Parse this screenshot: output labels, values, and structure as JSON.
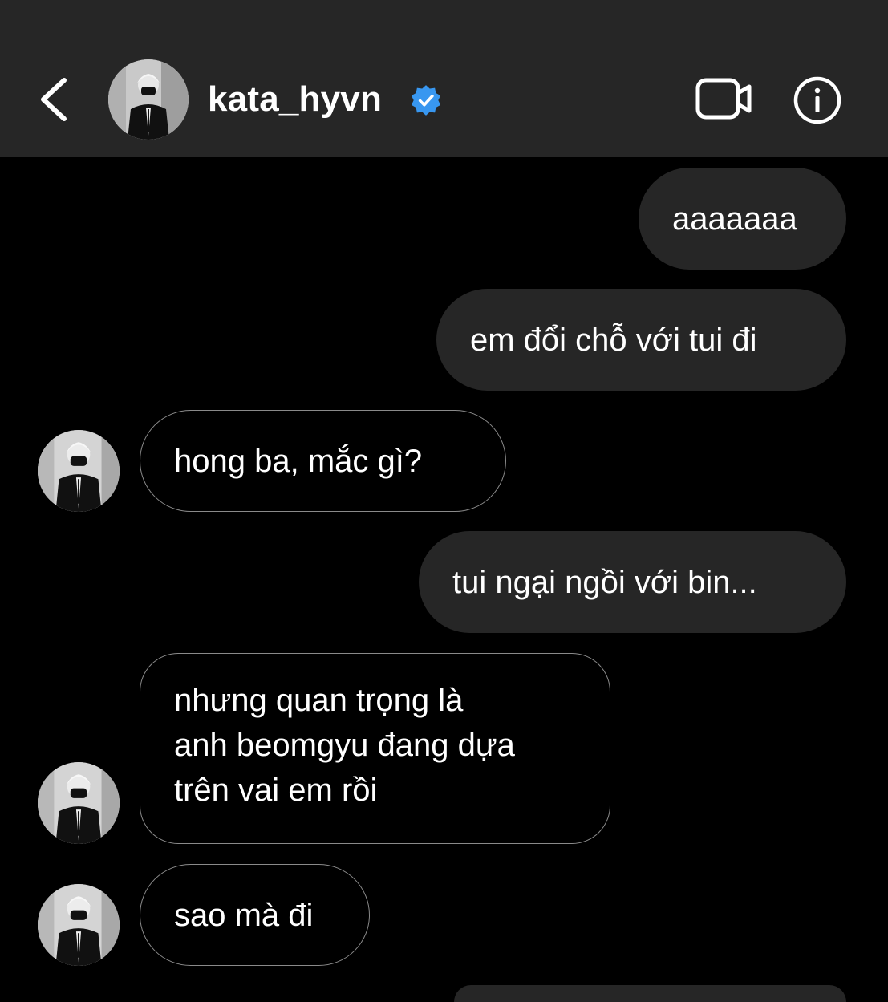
{
  "header": {
    "username": "kata_hyvn",
    "verified": true,
    "icons": [
      "back-chevron-icon",
      "avatar",
      "verified-badge-icon",
      "video-call-icon",
      "info-icon"
    ]
  },
  "messages": [
    {
      "side": "sent",
      "text": "aaaaaaa"
    },
    {
      "side": "sent",
      "text": "em đổi chỗ với tui đi"
    },
    {
      "side": "received",
      "text": "hong ba, mắc gì?"
    },
    {
      "side": "sent",
      "text": "tui ngại ngồi với bin..."
    },
    {
      "side": "received",
      "lines": [
        "nhưng quan trọng là",
        "anh beomgyu đang dựa",
        "trên vai em rồi"
      ]
    },
    {
      "side": "received",
      "text": "sao mà đi"
    }
  ],
  "colors": {
    "background": "#000000",
    "header_bg": "#262626",
    "sent_bubble": "#262626",
    "received_border": "#8a8a8a",
    "verified_badge": "#3897f0",
    "text": "#ffffff"
  }
}
